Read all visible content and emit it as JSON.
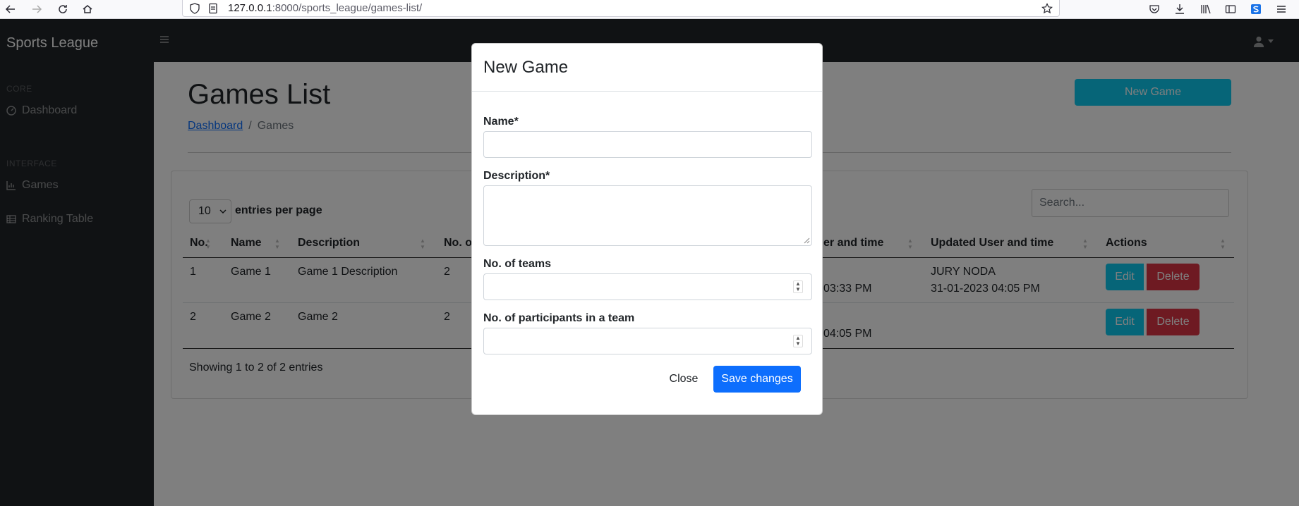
{
  "browser": {
    "url_host": "127.0.0.1",
    "url_rest": ":8000/sports_league/games-list/"
  },
  "app": {
    "brand": "Sports League",
    "sidebar": {
      "heading_core": "CORE",
      "heading_interface": "INTERFACE",
      "items": [
        {
          "label": "Dashboard",
          "icon": "dashboard-icon"
        },
        {
          "label": "Games",
          "icon": "chart-icon"
        },
        {
          "label": "Ranking Table",
          "icon": "table-icon"
        }
      ]
    }
  },
  "page": {
    "title": "Games List",
    "new_game_label": "New Game",
    "breadcrumb": {
      "link": "Dashboard",
      "separator": "/",
      "current": "Games"
    },
    "entries_value": "10",
    "entries_label": "entries per page",
    "search_placeholder": "Search...",
    "columns": [
      "No.",
      "Name",
      "Description",
      "No. o",
      "er and time",
      "Updated User and time",
      "Actions"
    ],
    "rows": [
      {
        "no": "1",
        "name": "Game 1",
        "description": "Game 1 Description",
        "teams": "2",
        "created_tail": "03:33 PM",
        "updated_user": "JURY NODA",
        "updated_time": "31-01-2023 04:05 PM"
      },
      {
        "no": "2",
        "name": "Game 2",
        "description": "Game 2",
        "teams": "2",
        "created_tail": "04:05 PM",
        "updated_user": "",
        "updated_time": ""
      }
    ],
    "edit_label": "Edit",
    "delete_label": "Delete",
    "showing": "Showing 1 to 2 of 2 entries"
  },
  "modal": {
    "title": "New Game",
    "name_label": "Name*",
    "description_label": "Description*",
    "teams_label": "No. of teams",
    "participants_label": "No. of participants in a team",
    "close_label": "Close",
    "save_label": "Save changes"
  },
  "colors": {
    "info": "#0dcaf0",
    "danger": "#dc3545",
    "primary": "#0d6efd",
    "dark": "#212529"
  }
}
